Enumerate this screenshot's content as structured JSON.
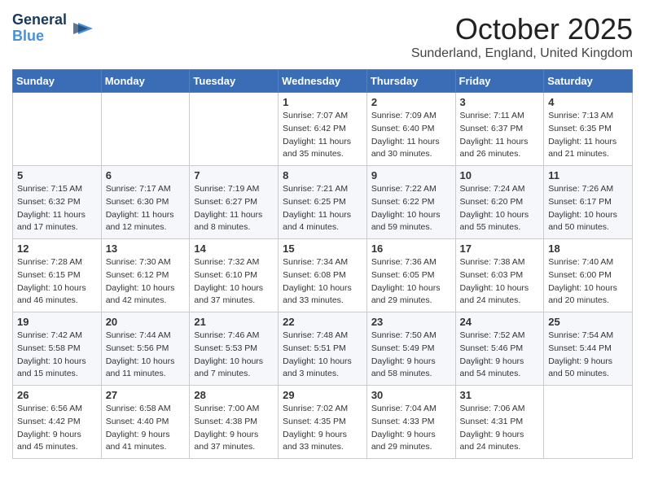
{
  "logo": {
    "line1": "General",
    "line2": "Blue"
  },
  "title": "October 2025",
  "location": "Sunderland, England, United Kingdom",
  "days_of_week": [
    "Sunday",
    "Monday",
    "Tuesday",
    "Wednesday",
    "Thursday",
    "Friday",
    "Saturday"
  ],
  "weeks": [
    [
      {
        "day": "",
        "empty": true
      },
      {
        "day": "",
        "empty": true
      },
      {
        "day": "",
        "empty": true
      },
      {
        "day": "1",
        "sunrise": "7:07 AM",
        "sunset": "6:42 PM",
        "daylight": "11 hours and 35 minutes."
      },
      {
        "day": "2",
        "sunrise": "7:09 AM",
        "sunset": "6:40 PM",
        "daylight": "11 hours and 30 minutes."
      },
      {
        "day": "3",
        "sunrise": "7:11 AM",
        "sunset": "6:37 PM",
        "daylight": "11 hours and 26 minutes."
      },
      {
        "day": "4",
        "sunrise": "7:13 AM",
        "sunset": "6:35 PM",
        "daylight": "11 hours and 21 minutes."
      }
    ],
    [
      {
        "day": "5",
        "sunrise": "7:15 AM",
        "sunset": "6:32 PM",
        "daylight": "11 hours and 17 minutes."
      },
      {
        "day": "6",
        "sunrise": "7:17 AM",
        "sunset": "6:30 PM",
        "daylight": "11 hours and 12 minutes."
      },
      {
        "day": "7",
        "sunrise": "7:19 AM",
        "sunset": "6:27 PM",
        "daylight": "11 hours and 8 minutes."
      },
      {
        "day": "8",
        "sunrise": "7:21 AM",
        "sunset": "6:25 PM",
        "daylight": "11 hours and 4 minutes."
      },
      {
        "day": "9",
        "sunrise": "7:22 AM",
        "sunset": "6:22 PM",
        "daylight": "10 hours and 59 minutes."
      },
      {
        "day": "10",
        "sunrise": "7:24 AM",
        "sunset": "6:20 PM",
        "daylight": "10 hours and 55 minutes."
      },
      {
        "day": "11",
        "sunrise": "7:26 AM",
        "sunset": "6:17 PM",
        "daylight": "10 hours and 50 minutes."
      }
    ],
    [
      {
        "day": "12",
        "sunrise": "7:28 AM",
        "sunset": "6:15 PM",
        "daylight": "10 hours and 46 minutes."
      },
      {
        "day": "13",
        "sunrise": "7:30 AM",
        "sunset": "6:12 PM",
        "daylight": "10 hours and 42 minutes."
      },
      {
        "day": "14",
        "sunrise": "7:32 AM",
        "sunset": "6:10 PM",
        "daylight": "10 hours and 37 minutes."
      },
      {
        "day": "15",
        "sunrise": "7:34 AM",
        "sunset": "6:08 PM",
        "daylight": "10 hours and 33 minutes."
      },
      {
        "day": "16",
        "sunrise": "7:36 AM",
        "sunset": "6:05 PM",
        "daylight": "10 hours and 29 minutes."
      },
      {
        "day": "17",
        "sunrise": "7:38 AM",
        "sunset": "6:03 PM",
        "daylight": "10 hours and 24 minutes."
      },
      {
        "day": "18",
        "sunrise": "7:40 AM",
        "sunset": "6:00 PM",
        "daylight": "10 hours and 20 minutes."
      }
    ],
    [
      {
        "day": "19",
        "sunrise": "7:42 AM",
        "sunset": "5:58 PM",
        "daylight": "10 hours and 15 minutes."
      },
      {
        "day": "20",
        "sunrise": "7:44 AM",
        "sunset": "5:56 PM",
        "daylight": "10 hours and 11 minutes."
      },
      {
        "day": "21",
        "sunrise": "7:46 AM",
        "sunset": "5:53 PM",
        "daylight": "10 hours and 7 minutes."
      },
      {
        "day": "22",
        "sunrise": "7:48 AM",
        "sunset": "5:51 PM",
        "daylight": "10 hours and 3 minutes."
      },
      {
        "day": "23",
        "sunrise": "7:50 AM",
        "sunset": "5:49 PM",
        "daylight": "9 hours and 58 minutes."
      },
      {
        "day": "24",
        "sunrise": "7:52 AM",
        "sunset": "5:46 PM",
        "daylight": "9 hours and 54 minutes."
      },
      {
        "day": "25",
        "sunrise": "7:54 AM",
        "sunset": "5:44 PM",
        "daylight": "9 hours and 50 minutes."
      }
    ],
    [
      {
        "day": "26",
        "sunrise": "6:56 AM",
        "sunset": "4:42 PM",
        "daylight": "9 hours and 45 minutes."
      },
      {
        "day": "27",
        "sunrise": "6:58 AM",
        "sunset": "4:40 PM",
        "daylight": "9 hours and 41 minutes."
      },
      {
        "day": "28",
        "sunrise": "7:00 AM",
        "sunset": "4:38 PM",
        "daylight": "9 hours and 37 minutes."
      },
      {
        "day": "29",
        "sunrise": "7:02 AM",
        "sunset": "4:35 PM",
        "daylight": "9 hours and 33 minutes."
      },
      {
        "day": "30",
        "sunrise": "7:04 AM",
        "sunset": "4:33 PM",
        "daylight": "9 hours and 29 minutes."
      },
      {
        "day": "31",
        "sunrise": "7:06 AM",
        "sunset": "4:31 PM",
        "daylight": "9 hours and 24 minutes."
      },
      {
        "day": "",
        "empty": true
      }
    ]
  ],
  "labels": {
    "sunrise_prefix": "Sunrise: ",
    "sunset_prefix": "Sunset: ",
    "daylight_prefix": "Daylight: "
  }
}
